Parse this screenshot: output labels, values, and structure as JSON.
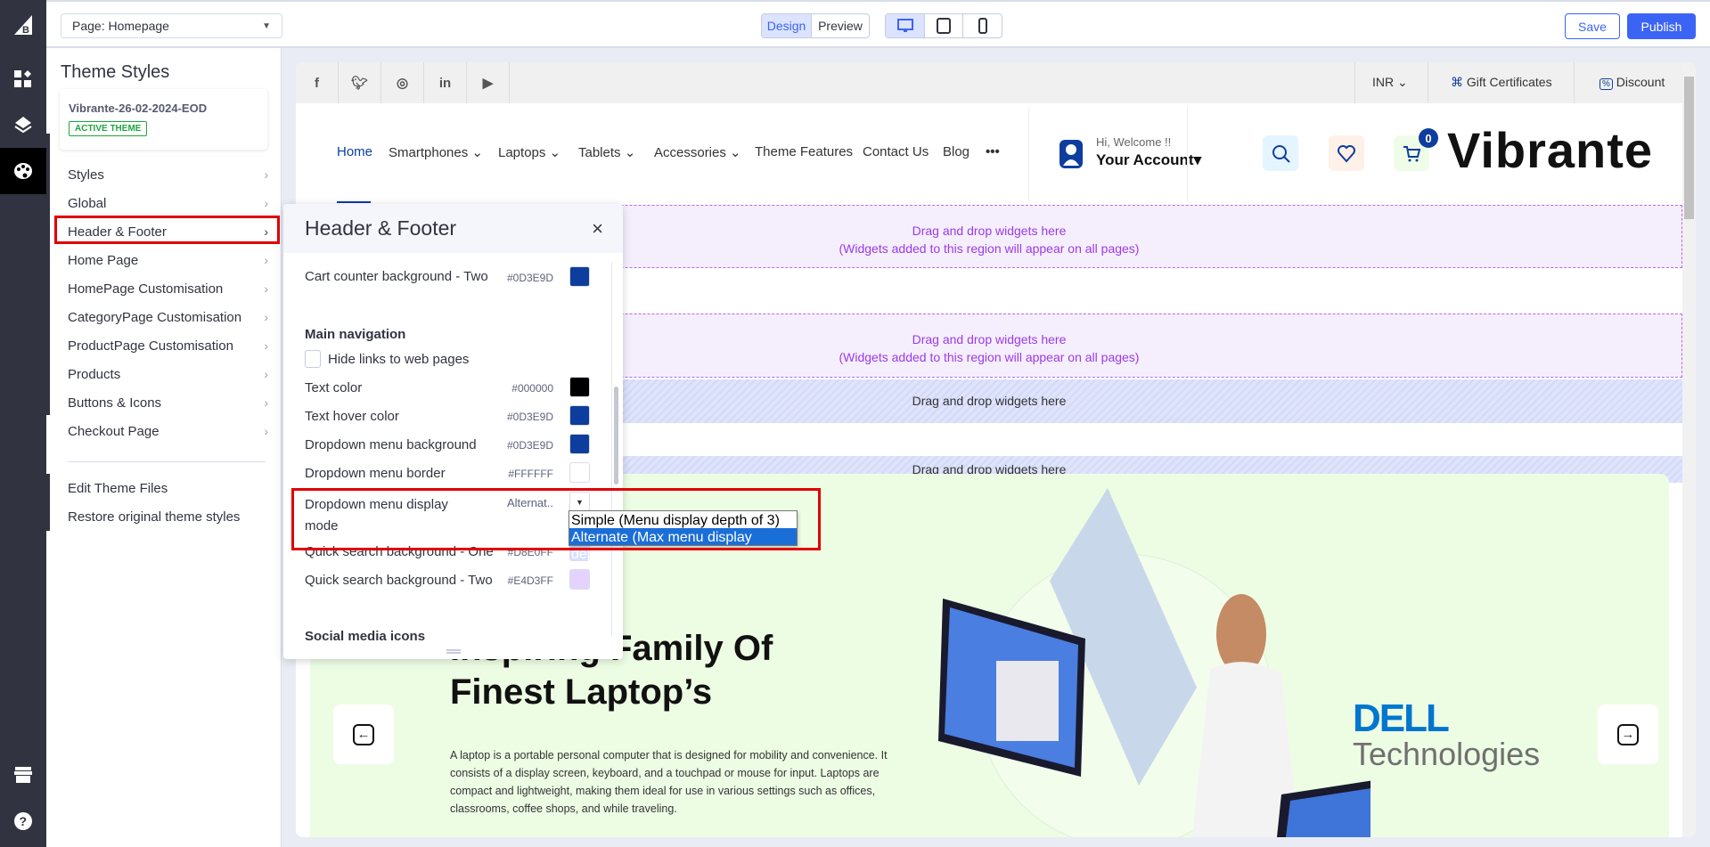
{
  "topbar": {
    "page_select": "Page: Homepage",
    "modes": [
      "Design",
      "Preview"
    ],
    "active_mode": "Design",
    "devices": [
      "desktop-icon",
      "tablet-icon",
      "mobile-icon"
    ],
    "save": "Save",
    "publish": "Publish",
    "accent": "#3c64f4"
  },
  "rail": {
    "icons": [
      "bigcommerce-logo",
      "widgets-icon",
      "layers-icon",
      "palette-icon",
      "storefront-icon",
      "help-icon"
    ]
  },
  "sidebar": {
    "title": "Theme Styles",
    "theme_name": "Vibrante-26-02-2024-EOD",
    "active_badge": "ACTIVE THEME",
    "items": [
      {
        "label": "Styles"
      },
      {
        "label": "Global"
      },
      {
        "label": "Header & Footer"
      },
      {
        "label": "Home Page"
      },
      {
        "label": "HomePage Customisation"
      },
      {
        "label": "CategoryPage Customisation"
      },
      {
        "label": "ProductPage Customisation"
      },
      {
        "label": "Products"
      },
      {
        "label": "Buttons & Icons"
      },
      {
        "label": "Checkout Page"
      }
    ],
    "links": [
      "Edit Theme Files",
      "Restore original theme styles"
    ]
  },
  "panel": {
    "title": "Header & Footer",
    "cart_counter": {
      "label": "Cart counter background - Two",
      "hex": "#0D3E9D"
    },
    "section": "Main navigation",
    "hide_links": {
      "label": "Hide links to web pages",
      "checked": false
    },
    "rows": [
      {
        "label": "Text color",
        "hex": "#000000"
      },
      {
        "label": "Text hover color",
        "hex": "#0D3E9D"
      },
      {
        "label": "Dropdown menu background",
        "hex": "#0D3E9D"
      },
      {
        "label": "Dropdown menu border",
        "hex": "#FFFFFF"
      }
    ],
    "display_mode": {
      "label": "Dropdown menu display mode",
      "value": "Alternat..",
      "options": [
        "Simple (Menu display depth of 3)",
        "Alternate (Max menu display depth)"
      ],
      "selected": 1
    },
    "rows2": [
      {
        "label": "Quick search background - One",
        "hex": "#D8E0FF"
      },
      {
        "label": "Quick search background - Two",
        "hex": "#E4D3FF"
      }
    ],
    "section2": "Social media icons"
  },
  "store": {
    "social": [
      "facebook-icon",
      "twitter-icon",
      "instagram-icon",
      "linkedin-icon",
      "youtube-icon"
    ],
    "currency": "INR",
    "gift": "Gift Certificates",
    "discount": "Discount",
    "nav": [
      {
        "label": "Home",
        "dd": false
      },
      {
        "label": "Smartphones",
        "dd": true
      },
      {
        "label": "Laptops",
        "dd": true
      },
      {
        "label": "Tablets",
        "dd": true
      },
      {
        "label": "Accessories",
        "dd": true
      },
      {
        "label": "Theme Features",
        "dd": false
      },
      {
        "label": "Contact Us",
        "dd": false
      },
      {
        "label": "Blog",
        "dd": false
      }
    ],
    "more": "•••",
    "welcome": "Hi, Welcome !!",
    "account": "Your Account",
    "cart_count": "0",
    "logo": "Vibrante",
    "drop1": "Drag and drop widgets here",
    "drop1b": "(Widgets added to this region will appear on all pages)",
    "drop3": "Drag and drop widgets here",
    "drop4": "Drag and drop widgets here",
    "hero_title1": "Inspiring Family Of",
    "hero_title2": "Finest Laptop’s",
    "hero_text": "A laptop is a portable personal computer that is designed for mobility and convenience. It consists of a display screen, keyboard, and a touchpad or mouse for input. Laptops are compact and lightweight, making them ideal for use in various settings such as offices, classrooms, coffee shops, and while traveling.",
    "brand1": "DELL",
    "brand2": "Technologies"
  }
}
